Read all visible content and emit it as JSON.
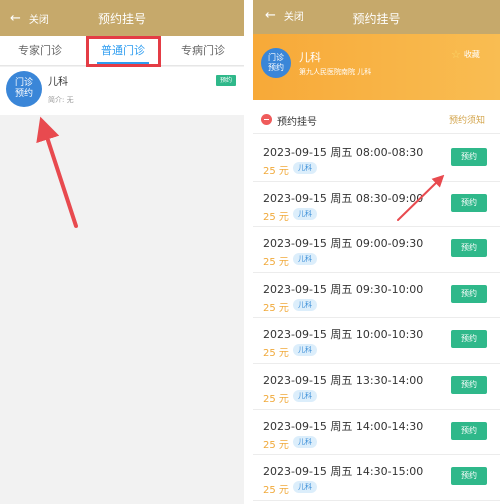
{
  "left": {
    "nav": {
      "back_label": "关闭",
      "title": "预约挂号"
    },
    "tabs": {
      "expert": "专家门诊",
      "general": "普通门诊",
      "disease": "专病门诊"
    },
    "dept": {
      "avatar_line1": "门诊",
      "avatar_line2": "预约",
      "name": "儿科",
      "intro": "简介: 无",
      "badge": "预约"
    }
  },
  "right": {
    "nav": {
      "back_label": "关闭",
      "title": "预约挂号"
    },
    "hero": {
      "avatar_line1": "门诊",
      "avatar_line2": "预约",
      "name": "儿科",
      "subtitle": "第九人民医院南院  儿科",
      "favorite": "收藏"
    },
    "section": {
      "title": "预约挂号",
      "notice": "预约须知"
    },
    "slots": [
      {
        "time": "2023-09-15  周五  08:00-08:30",
        "price": "25 元",
        "tag": "儿科",
        "button": "预约"
      },
      {
        "time": "2023-09-15  周五  08:30-09:00",
        "price": "25 元",
        "tag": "儿科",
        "button": "预约"
      },
      {
        "time": "2023-09-15  周五  09:00-09:30",
        "price": "25 元",
        "tag": "儿科",
        "button": "预约"
      },
      {
        "time": "2023-09-15  周五  09:30-10:00",
        "price": "25 元",
        "tag": "儿科",
        "button": "预约"
      },
      {
        "time": "2023-09-15  周五  10:00-10:30",
        "price": "25 元",
        "tag": "儿科",
        "button": "预约"
      },
      {
        "time": "2023-09-15  周五  13:30-14:00",
        "price": "25 元",
        "tag": "儿科",
        "button": "预约"
      },
      {
        "time": "2023-09-15  周五  14:00-14:30",
        "price": "25 元",
        "tag": "儿科",
        "button": "预约"
      },
      {
        "time": "2023-09-15  周五  14:30-15:00",
        "price": "25 元",
        "tag": "儿科",
        "button": "预约"
      }
    ]
  },
  "colors": {
    "navbar": "#c6a96b",
    "tab_active": "#2e9df0",
    "highlight": "#e43c45",
    "avatar": "#3a86d8",
    "hero": "#f7a938",
    "book_button": "#2fb88a",
    "price": "#f0a93a",
    "annotation_arrow": "#e84a4f"
  },
  "icons": {
    "back": "arrow-left-icon",
    "favorite": "star-outline-icon",
    "section": "minus-circle-icon"
  }
}
